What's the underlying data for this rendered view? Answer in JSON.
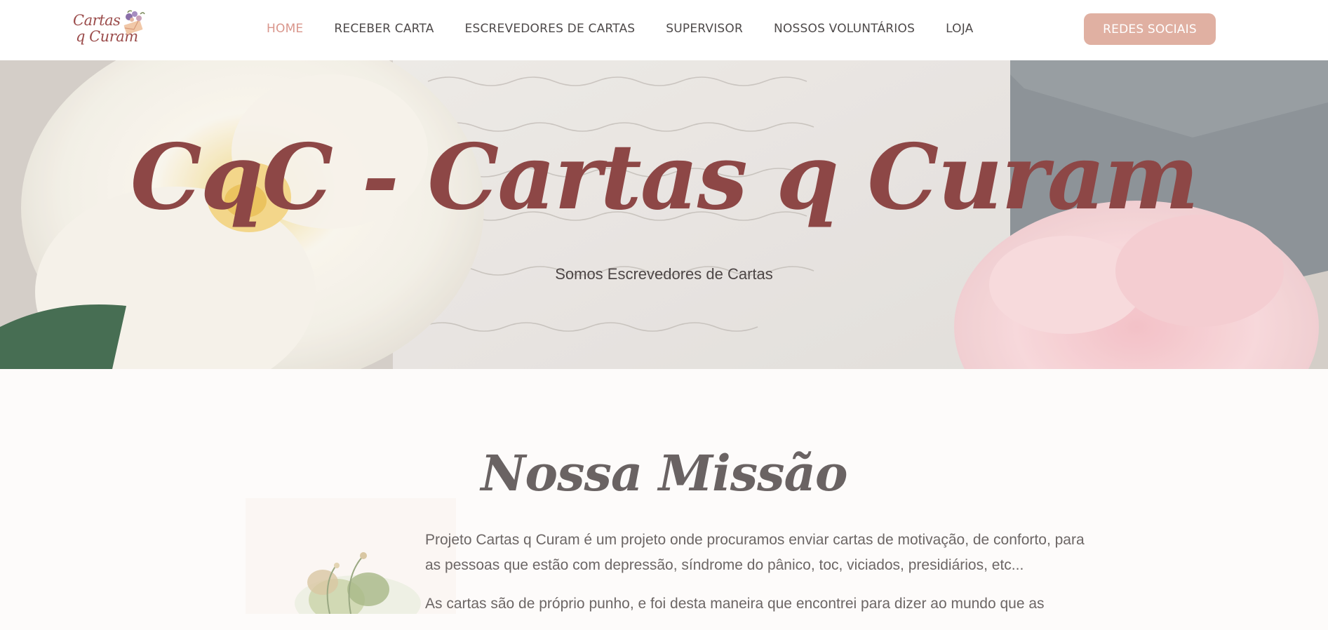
{
  "header": {
    "logo_line1": "Cartas",
    "logo_line2": "q Curam",
    "nav": [
      {
        "label": "HOME",
        "active": true
      },
      {
        "label": "RECEBER CARTA",
        "active": false
      },
      {
        "label": "ESCREVEDORES DE CARTAS",
        "active": false
      },
      {
        "label": "SUPERVISOR",
        "active": false
      },
      {
        "label": "NOSSOS VOLUNTÁRIOS",
        "active": false
      },
      {
        "label": "LOJA",
        "active": false
      }
    ],
    "cta_label": "REDES SOCIAIS"
  },
  "hero": {
    "title": "CqC - Cartas q Curam",
    "subtitle": "Somos Escrevedores de Cartas"
  },
  "mission": {
    "title": "Nossa Missão",
    "paragraphs": [
      "Projeto Cartas q Curam é um projeto onde procuramos enviar cartas de motivação, de conforto, para as pessoas que estão com depressão, síndrome do pânico, toc, viciados, presidiários, etc...",
      "As cartas são de próprio punho, e foi desta maneira que encontrei para dizer ao mundo que as"
    ]
  },
  "colors": {
    "brand": "#9b4c4b",
    "nav_active": "#d9968c",
    "cta_bg": "#e0b0a2",
    "hero_title": "#8d4746"
  }
}
